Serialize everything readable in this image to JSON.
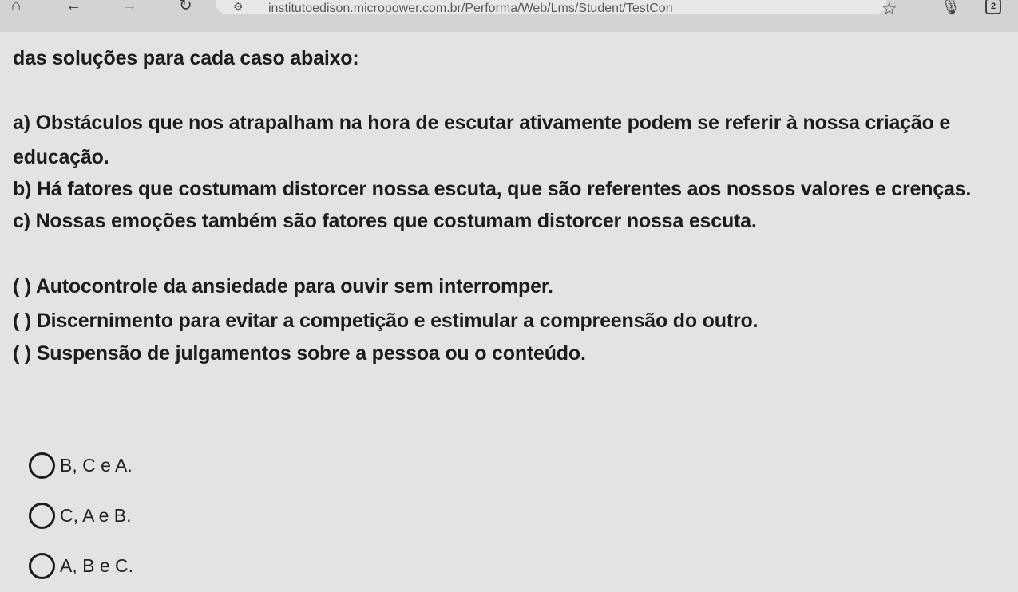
{
  "browser": {
    "url": "institutoedison.micropower.com.br/Performa/Web/Lms/Student/TestCon",
    "site_info_icon": "tune-icon",
    "tab_count": "2",
    "icons": [
      "home-icon",
      "back-icon",
      "forward-icon",
      "reload-icon",
      "star-icon",
      "mic-icon",
      "tabs-icon"
    ]
  },
  "question": {
    "intro": "das soluções para cada caso abaixo:",
    "case_a_line1": "a) Obstáculos que nos atrapalham na hora de escutar ativamente podem se referir à nossa criação e",
    "case_a_line2": "educação.",
    "case_b": "b) Há fatores que costumam distorcer nossa escuta, que são referentes aos nossos valores e crenças.",
    "case_c": "c) Nossas emoções também são fatores que costumam distorcer nossa escuta.",
    "solutions": [
      "( ) Autocontrole da ansiedade para ouvir sem interromper.",
      "( ) Discernimento para evitar a competição e estimular a compreensão do outro.",
      "( ) Suspensão de julgamentos sobre a pessoa ou o conteúdo."
    ]
  },
  "answers": {
    "options": [
      "B, C e A.",
      "C, A e B.",
      "A, B e C."
    ]
  }
}
